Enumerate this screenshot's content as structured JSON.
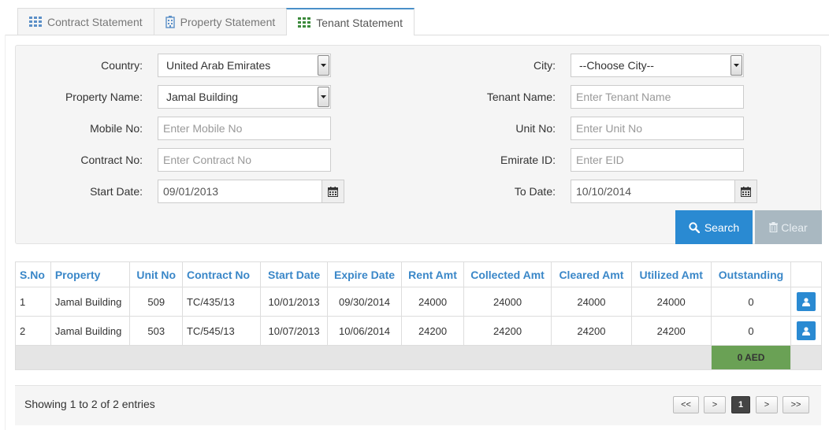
{
  "tabs": [
    {
      "label": "Contract Statement",
      "icon": "grid-icon"
    },
    {
      "label": "Property Statement",
      "icon": "building-icon"
    },
    {
      "label": "Tenant Statement",
      "icon": "grid-icon",
      "active": true
    }
  ],
  "form": {
    "country_label": "Country:",
    "country_value": "United Arab Emirates",
    "city_label": "City:",
    "city_value": "--Choose City--",
    "property_label": "Property Name:",
    "property_value": "Jamal Building",
    "tenant_label": "Tenant Name:",
    "tenant_placeholder": "Enter Tenant Name",
    "mobile_label": "Mobile No:",
    "mobile_placeholder": "Enter Mobile No",
    "unit_label": "Unit No:",
    "unit_placeholder": "Enter Unit No",
    "contract_label": "Contract No:",
    "contract_placeholder": "Enter Contract No",
    "eid_label": "Emirate ID:",
    "eid_placeholder": "Enter EID",
    "start_label": "Start Date:",
    "start_value": "09/01/2013",
    "to_label": "To Date:",
    "to_value": "10/10/2014",
    "search_label": "Search",
    "clear_label": "Clear"
  },
  "table": {
    "headers": [
      "S.No",
      "Property",
      "Unit No",
      "Contract No",
      "Start Date",
      "Expire Date",
      "Rent Amt",
      "Collected Amt",
      "Cleared Amt",
      "Utilized Amt",
      "Outstanding"
    ],
    "rows": [
      [
        "1",
        "Jamal Building",
        "509",
        "TC/435/13",
        "10/01/2013",
        "09/30/2014",
        "24000",
        "24000",
        "24000",
        "24000",
        "0"
      ],
      [
        "2",
        "Jamal Building",
        "503",
        "TC/545/13",
        "10/07/2013",
        "10/06/2014",
        "24200",
        "24200",
        "24200",
        "24200",
        "0"
      ]
    ],
    "total_outstanding": "0 AED"
  },
  "footer": {
    "entries_text": "Showing 1 to 2 of 2 entries",
    "first": "<<",
    "prev": ">",
    "page": "1",
    "next": ">",
    "last": ">>"
  },
  "colors": {
    "accent": "#2a8ad2",
    "header_text": "#3a87c8",
    "total_bg": "#6aa155",
    "clear_bg": "#a9b8c1"
  }
}
